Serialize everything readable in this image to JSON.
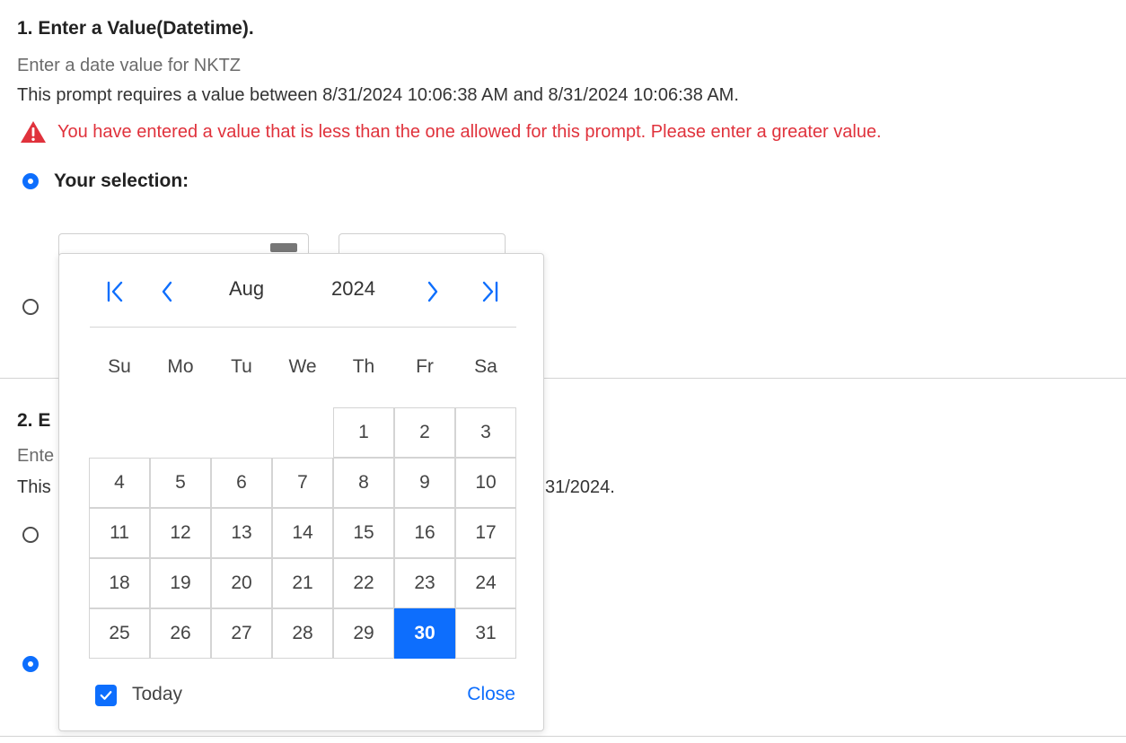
{
  "section1": {
    "title": "1.  Enter a Value(Datetime).",
    "subtitle": "Enter a date value for NKTZ",
    "requirement": "This prompt requires a value between 8/31/2024 10:06:38 AM and 8/31/2024 10:06:38 AM.",
    "error": "You have entered a value that is less than the one allowed for this prompt. Please enter a greater value.",
    "selection_label": "Your selection:"
  },
  "section2": {
    "title_fragment": "2.  E",
    "subtitle_fragment": "Ente",
    "requirement_prefix": "This",
    "requirement_suffix": "31/2024."
  },
  "colors": {
    "accent": "#0d6efd",
    "error": "#e0323c"
  },
  "calendar": {
    "month": "Aug",
    "year": "2024",
    "weekdays": [
      "Su",
      "Mo",
      "Tu",
      "We",
      "Th",
      "Fr",
      "Sa"
    ],
    "first_weekday_index": 4,
    "days_in_month": 31,
    "selected_day": 30,
    "today_checked": true,
    "today_label": "Today",
    "close_label": "Close",
    "icons": {
      "first": "first-page-icon",
      "prev": "chevron-left-icon",
      "next": "chevron-right-icon",
      "last": "last-page-icon"
    }
  }
}
